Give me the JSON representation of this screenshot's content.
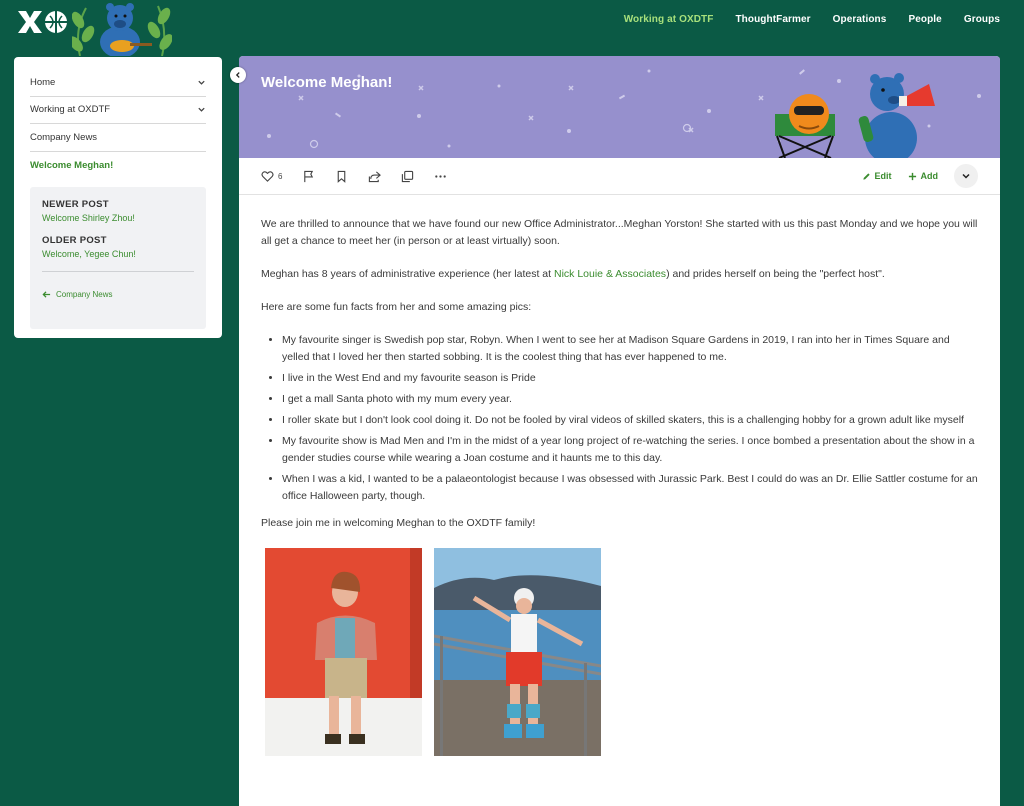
{
  "nav": {
    "items": [
      {
        "label": "Working at OXDTF",
        "active": true
      },
      {
        "label": "ThoughtFarmer",
        "active": false
      },
      {
        "label": "Operations",
        "active": false
      },
      {
        "label": "People",
        "active": false
      },
      {
        "label": "Groups",
        "active": false
      }
    ]
  },
  "sidebar": {
    "items": [
      {
        "label": "Home",
        "icon": "chevron-down-icon"
      },
      {
        "label": "Working at OXDTF",
        "icon": "chevron-down-icon"
      },
      {
        "label": "Company News"
      },
      {
        "label": "Welcome Meghan!"
      }
    ],
    "newer_heading": "NEWER POST",
    "newer_link": "Welcome Shirley Zhou!",
    "older_heading": "OLDER POST",
    "older_link": "Welcome, Yegee Chun!",
    "back_link": "Company News"
  },
  "post": {
    "title": "Welcome Meghan!",
    "like_count": "6",
    "edit_label": "Edit",
    "add_label": "Add",
    "intro": "We are thrilled to announce that we have found our new Office Administrator...Meghan Yorston!  She started with us this past Monday  and we hope you will all get a chance to meet her (in person or at least virtually) soon.",
    "para2_before": "Meghan has 8 years of administrative experience (her latest at ",
    "para2_link": "Nick Louie & Associates",
    "para2_after": ") and prides herself on being the \"perfect host\".",
    "para3": "Here are some fun facts from her and some amazing pics:",
    "facts": [
      "My favourite singer is Swedish pop star, Robyn. When I went to see her at Madison Square Gardens in 2019, I ran into her in Times Square and yelled that I loved her then started sobbing. It is the coolest thing that has ever happened to me.",
      "I live in the West End and my favourite season is Pride",
      "I get a mall Santa photo with my mum every year.",
      "I roller skate but I don't look cool doing it. Do not be fooled by viral videos of skilled skaters, this is a challenging hobby for a grown adult like myself",
      "My favourite show is Mad Men and I'm in the midst of a year long project of re-watching the series. I once bombed a presentation about the show in a gender studies course while wearing a Joan costume and it haunts me to this day.",
      "When I was a kid, I wanted to be a palaeontologist because I was obsessed with Jurassic Park. Best I could do was an Dr. Ellie Sattler costume for an office Halloween party, though."
    ],
    "closing": "Please join me in welcoming Meghan to the OXDTF family!"
  },
  "colors": {
    "background": "#0b5a45",
    "accent_green": "#3b8c2f",
    "nav_active": "#a8e07c",
    "banner": "#9690cd"
  }
}
